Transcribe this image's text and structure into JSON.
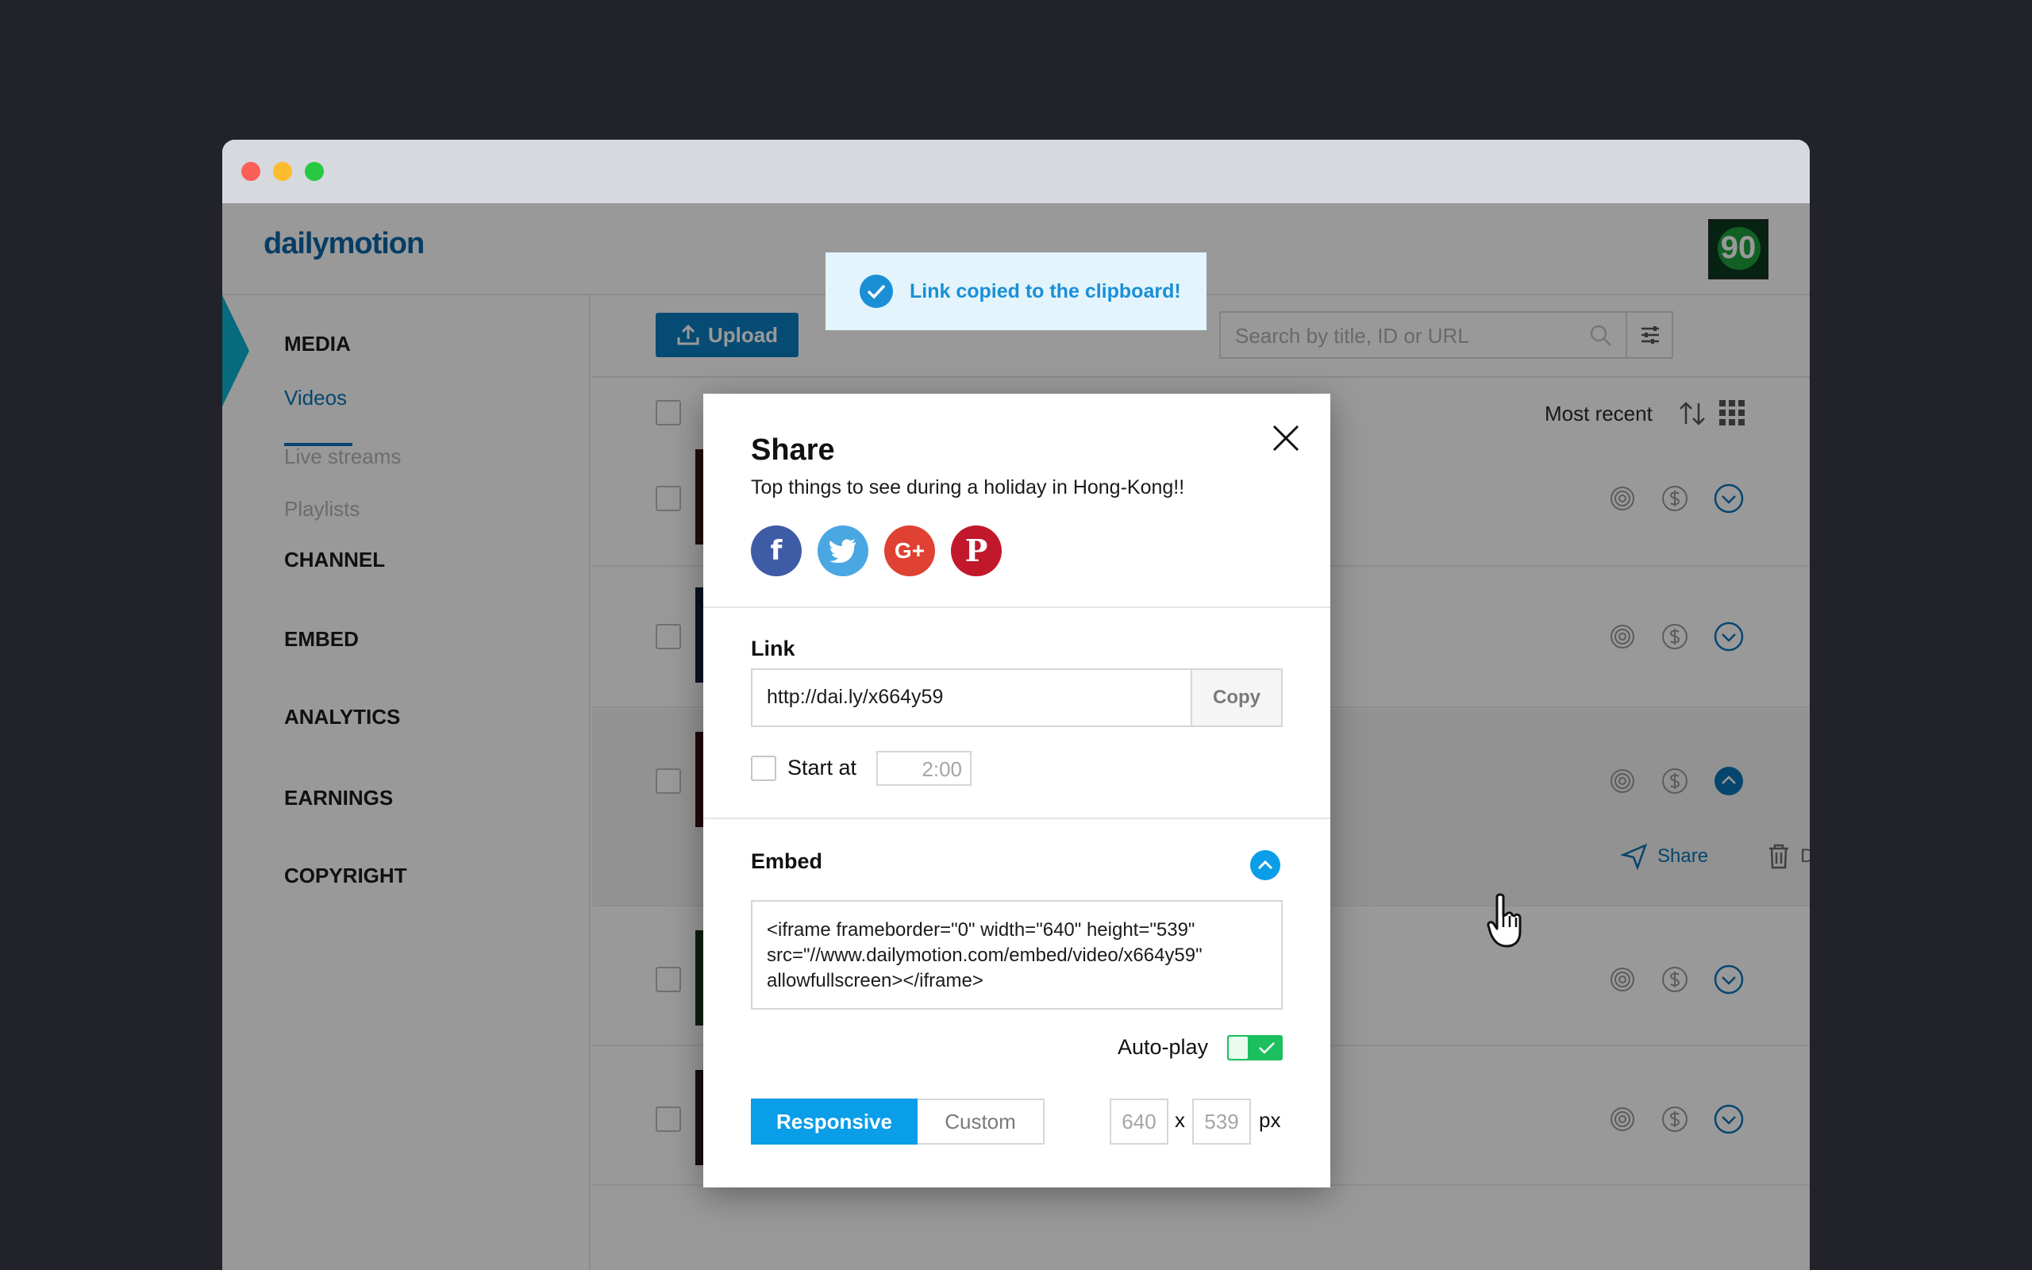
{
  "app": {
    "logo": "dailymotion",
    "avatar_text": "90"
  },
  "sidebar": {
    "sections": [
      "MEDIA",
      "CHANNEL",
      "EMBED",
      "ANALYTICS",
      "EARNINGS",
      "COPYRIGHT"
    ],
    "media_items": [
      "Videos",
      "Live streams",
      "Playlists"
    ]
  },
  "toolbar": {
    "upload_label": "Upload",
    "search_placeholder": "Search by title, ID or URL",
    "sort_label": "Most recent"
  },
  "row_actions": {
    "share_label": "Share",
    "delete_label": "Delete"
  },
  "toast": {
    "message": "Link copied to the clipboard!"
  },
  "share_modal": {
    "title": "Share",
    "video_title": "Top things to see during a holiday in Hong-Kong!!",
    "social": [
      "facebook-icon",
      "twitter-icon",
      "google-plus-icon",
      "pinterest-icon"
    ],
    "link_label": "Link",
    "link_value": "http://dai.ly/x664y59",
    "copy_label": "Copy",
    "start_at_label": "Start at",
    "start_at_value": "2:00",
    "embed_label": "Embed",
    "embed_code": "<iframe frameborder=\"0\" width=\"640\" height=\"539\" src=\"//www.dailymotion.com/embed/video/x664y59\" allowfullscreen></iframe>",
    "autoplay_label": "Auto-play",
    "autoplay_on": true,
    "responsive_label": "Responsive",
    "custom_label": "Custom",
    "width_value": "640",
    "height_value": "539",
    "x_label": "x",
    "px_label": "px"
  },
  "colors": {
    "brand_blue": "#0a74b8",
    "accent_blue": "#0a9de8",
    "toggle_green": "#1bbf5e",
    "background_dark": "#22222b"
  }
}
